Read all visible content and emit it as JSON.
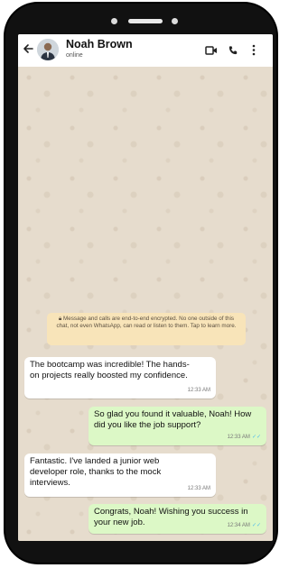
{
  "header": {
    "contact_name": "Noah Brown",
    "status": "online",
    "back_icon": "arrow-left-icon",
    "video_icon": "video-camera-icon",
    "call_icon": "phone-icon",
    "more_icon": "more-vertical-icon"
  },
  "encryption_notice": {
    "icon": "lock-icon",
    "text": "Message and calls are end-to-end encrypted. No one outside of this chat, not even WhatsApp, can read or listen to them. Tap to learn more."
  },
  "messages": [
    {
      "direction": "incoming",
      "text": "The bootcamp was incredible! The hands-on projects really boosted my confidence.",
      "time": "12:33 AM"
    },
    {
      "direction": "outgoing",
      "text": "So glad you found it valuable, Noah! How did you like the job support?",
      "time": "12:33 AM",
      "ticks": "✓✓"
    },
    {
      "direction": "incoming",
      "text": "Fantastic. I've landed a junior web developer role, thanks to the mock interviews.",
      "time": "12:33 AM"
    },
    {
      "direction": "outgoing",
      "text": "Congrats, Noah! Wishing you success in your new job.",
      "time": "12:34 AM",
      "ticks": "✓✓"
    }
  ],
  "colors": {
    "incoming_bubble": "#ffffff",
    "outgoing_bubble": "#dcf8c6",
    "encryption_bg": "#f8e4b9",
    "wallpaper": "#e6dccd",
    "read_ticks": "#53bdeb"
  }
}
